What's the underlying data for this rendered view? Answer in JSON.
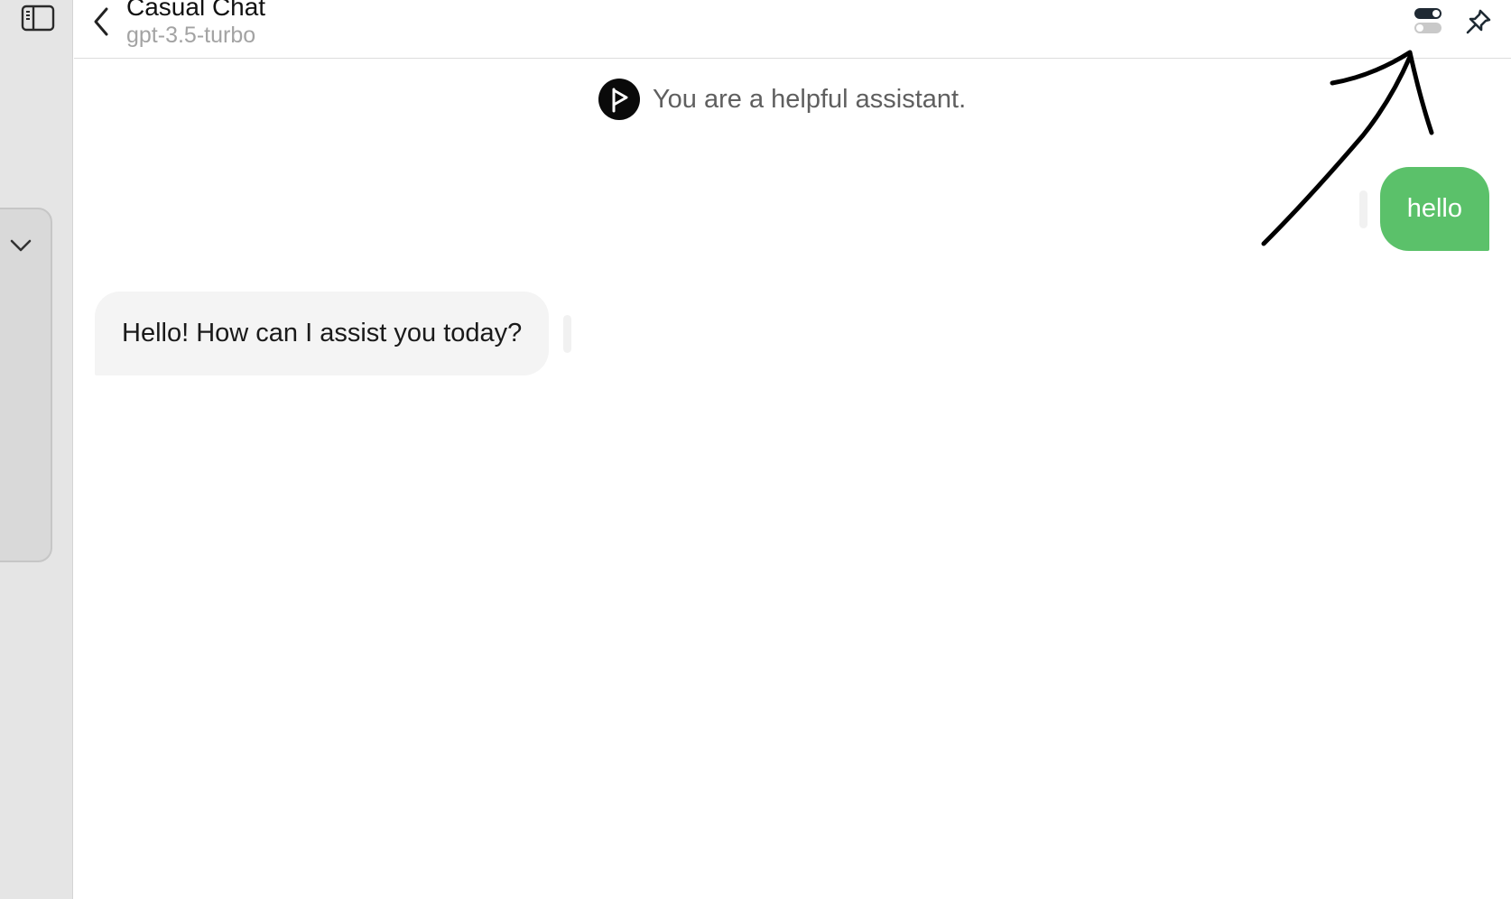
{
  "header": {
    "title": "Casual Chat",
    "model": "gpt-3.5-turbo"
  },
  "icons": {
    "sidebar_toggle": "sidebar-toggle-icon",
    "collapse": "chevron-down-icon",
    "back": "chevron-left-icon",
    "settings_toggle": "toggle-icon",
    "pin": "pin-icon",
    "system_avatar": "play-flag-icon",
    "annotation": "hand-drawn-arrow"
  },
  "system": {
    "prompt": "You are a helpful assistant."
  },
  "messages": [
    {
      "role": "user",
      "text": "hello"
    },
    {
      "role": "assistant",
      "text": "Hello! How can I assist you today?"
    }
  ],
  "colors": {
    "user_bubble": "#5bc16a",
    "assistant_bubble": "#f4f4f4",
    "sidebar": "#e5e5e5"
  }
}
